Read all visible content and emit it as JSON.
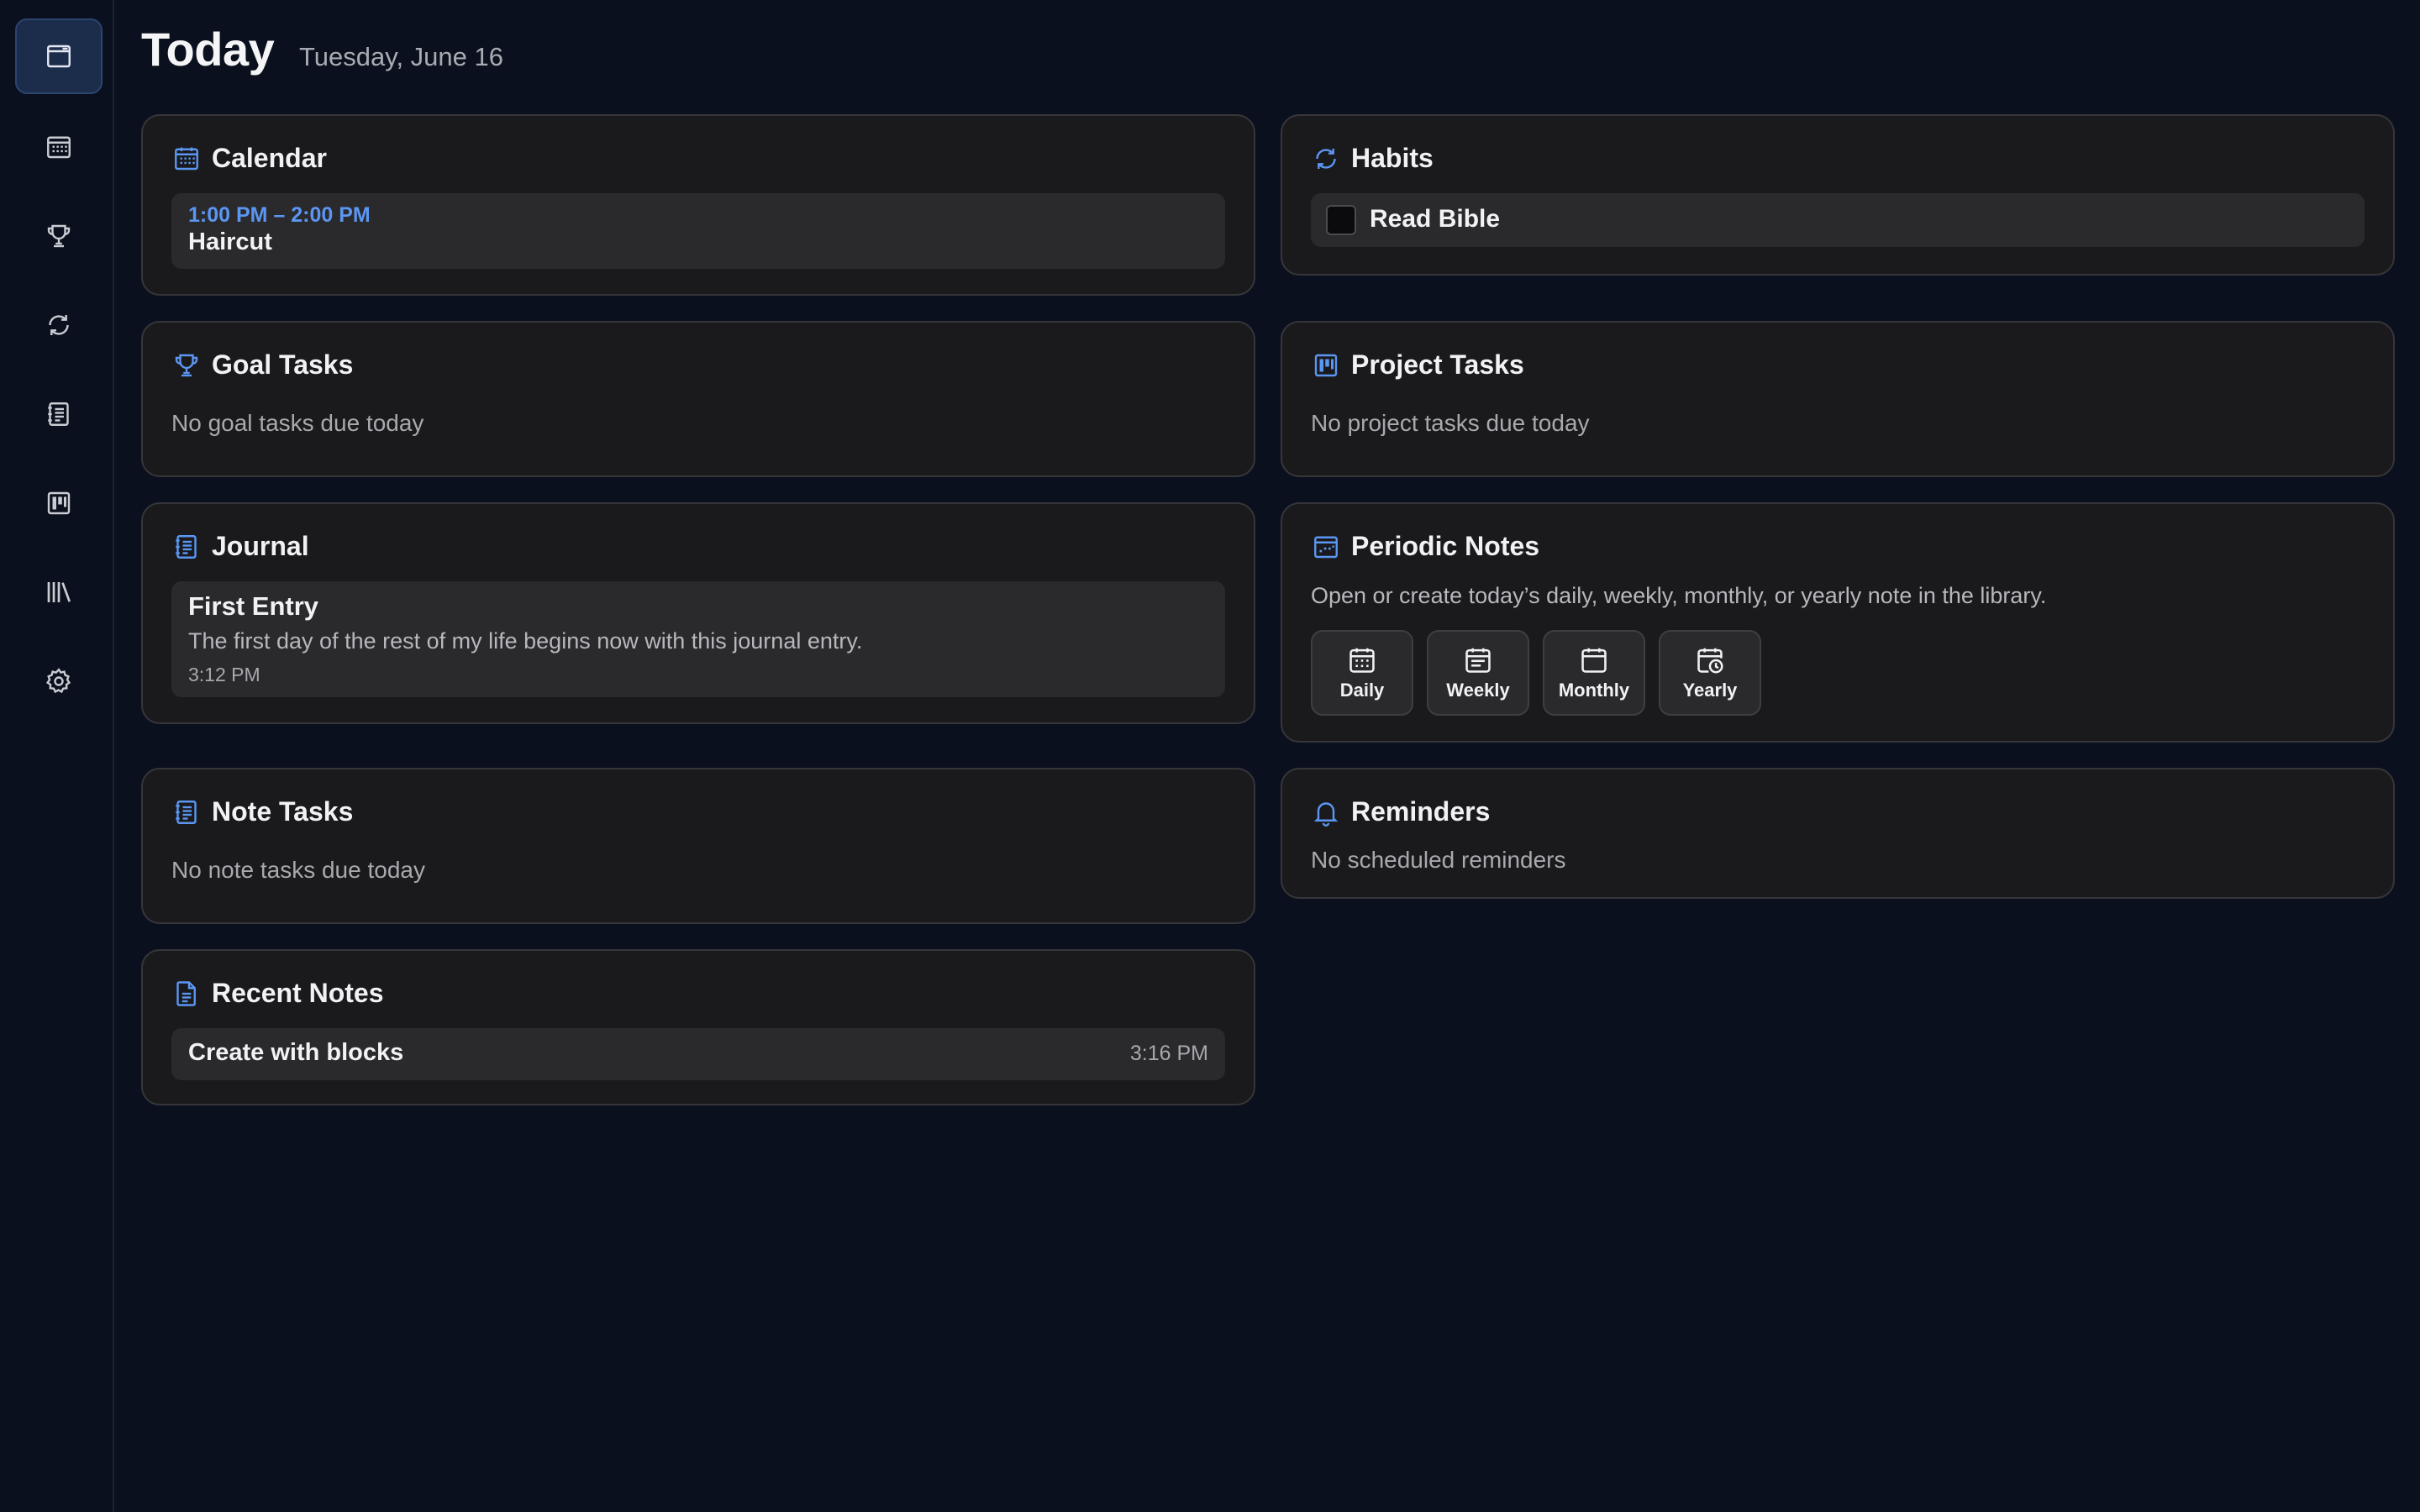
{
  "sidebar": {
    "items": [
      {
        "icon": "today-icon"
      },
      {
        "icon": "calendar-icon"
      },
      {
        "icon": "trophy-icon"
      },
      {
        "icon": "habits-icon"
      },
      {
        "icon": "journal-icon"
      },
      {
        "icon": "projects-icon"
      },
      {
        "icon": "library-icon"
      },
      {
        "icon": "gear-icon"
      }
    ]
  },
  "header": {
    "title": "Today",
    "date": "Tuesday, June 16"
  },
  "calendar": {
    "title": "Calendar",
    "event": {
      "time": "1:00 PM – 2:00 PM",
      "name": "Haircut"
    }
  },
  "habits": {
    "title": "Habits",
    "items": [
      {
        "label": "Read Bible"
      }
    ]
  },
  "goal_tasks": {
    "title": "Goal Tasks",
    "empty": "No goal tasks due today"
  },
  "project_tasks": {
    "title": "Project Tasks",
    "empty": "No project tasks due today"
  },
  "journal": {
    "title": "Journal",
    "entry": {
      "title": "First Entry",
      "body": "The first day of the rest of my life begins now with this journal entry.",
      "time": "3:12 PM"
    }
  },
  "periodic_notes": {
    "title": "Periodic Notes",
    "description": "Open or create today’s daily, weekly, monthly, or yearly note in the library.",
    "buttons": [
      {
        "label": "Daily"
      },
      {
        "label": "Weekly"
      },
      {
        "label": "Monthly"
      },
      {
        "label": "Yearly"
      }
    ]
  },
  "note_tasks": {
    "title": "Note Tasks",
    "empty": "No note tasks due today"
  },
  "reminders": {
    "title": "Reminders",
    "empty": "No scheduled reminders"
  },
  "recent_notes": {
    "title": "Recent Notes",
    "items": [
      {
        "name": "Create with blocks",
        "time": "3:16 PM"
      }
    ]
  },
  "colors": {
    "background": "#0a101d",
    "card": "#1a1a1c",
    "accent": "#5b96f2"
  }
}
